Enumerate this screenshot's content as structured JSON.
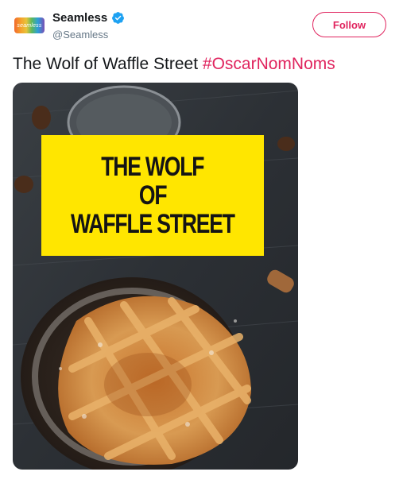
{
  "account": {
    "display_name": "Seamless",
    "handle": "@Seamless",
    "avatar_text": "seamless",
    "verified": true
  },
  "follow_label": "Follow",
  "tweet": {
    "text": "The Wolf of Waffle Street",
    "hashtag": "#OscarNomNoms"
  },
  "image": {
    "title_lines": [
      "THE WOLF",
      "OF",
      "WAFFLE STREET"
    ]
  },
  "colors": {
    "accent": "#e0245e",
    "verified": "#1da1f2",
    "title_box": "#ffe600"
  }
}
